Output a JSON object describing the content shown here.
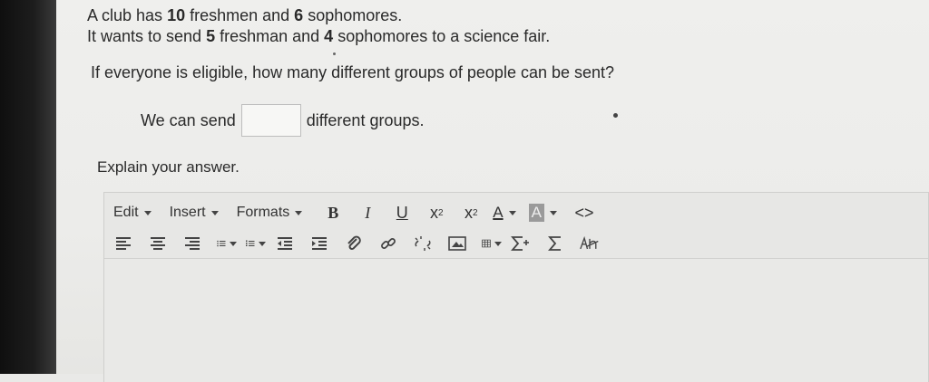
{
  "problem": {
    "line1_pre": "A club has ",
    "line1_num1": "10",
    "line1_mid": " freshmen and ",
    "line1_num2": "6",
    "line1_post": " sophomores.",
    "line2_pre": "It wants to send ",
    "line2_num1": "5",
    "line2_mid": " freshman and ",
    "line2_num2": "4",
    "line2_post": " sophomores to a science fair."
  },
  "question": "If everyone is eligible, how many different groups of people can be sent?",
  "answer": {
    "prefix": "We can send",
    "value": "",
    "suffix": "different groups."
  },
  "explain_label": "Explain your answer.",
  "editor": {
    "menus": [
      "Edit",
      "Insert",
      "Formats"
    ],
    "format_buttons": {
      "bold": "B",
      "italic": "I",
      "underline": "U",
      "subscript": "x",
      "subscript_mark": "2",
      "superscript": "x",
      "superscript_mark": "2",
      "text_color": "A",
      "bg_color": "A",
      "code": "<>"
    },
    "icons": [
      "align-left-icon",
      "align-center-icon",
      "align-right-icon",
      "bullet-list-icon",
      "numbered-list-icon",
      "outdent-icon",
      "indent-icon",
      "attachment-icon",
      "link-icon",
      "unlink-icon",
      "image-icon",
      "table-icon",
      "sigma-plus-icon",
      "sigma-icon",
      "handwriting-icon"
    ],
    "content": ""
  }
}
